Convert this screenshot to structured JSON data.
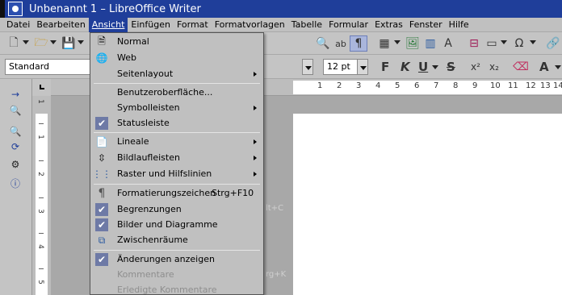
{
  "window": {
    "title": "Unbenannt 1 – LibreOffice Writer"
  },
  "menubar": {
    "items": [
      "Datei",
      "Bearbeiten",
      "Ansicht",
      "Einfügen",
      "Format",
      "Formatvorlagen",
      "Tabelle",
      "Formular",
      "Extras",
      "Fenster",
      "Hilfe"
    ],
    "active": "Ansicht"
  },
  "formatting": {
    "paragraph_style": "Standard",
    "font_size": "12 pt",
    "bold": "F",
    "italic": "K",
    "underline": "U",
    "strikethrough": "S",
    "superscript": "x²",
    "subscript": "x₂"
  },
  "ruler": {
    "h_numbers": [
      "1",
      "2",
      "3",
      "4",
      "5",
      "6",
      "7",
      "8",
      "9",
      "10",
      "11",
      "12",
      "13",
      "14"
    ],
    "v_numbers": [
      "1",
      "1",
      "2",
      "3",
      "4",
      "5"
    ]
  },
  "ghost_text": {
    "shortcut1": "lt+C",
    "shortcut2": "rg+K"
  },
  "view_menu": {
    "normal": "Normal",
    "web": "Web",
    "page_layout": "Seitenlayout",
    "ui": "Benutzeroberfläche...",
    "toolbars": "Symbolleisten",
    "status_bar": "Statusleiste",
    "rulers": "Lineale",
    "scrollbars": "Bildlaufleisten",
    "grid": "Raster und Hilfslinien",
    "formatting_marks": "Formatierungszeichen",
    "formatting_marks_shortcut": "Strg+F10",
    "boundaries": "Begrenzungen",
    "images": "Bilder und Diagramme",
    "whitespace": "Zwischenräume",
    "track_changes": "Änderungen anzeigen",
    "comments": "Kommentare",
    "resolved_comments": "Erledigte Kommentare"
  },
  "colors": {
    "title_bar": "#1f3e9a",
    "menu_highlight": "#1f3e9a",
    "check_bg": "#6e7aa6",
    "menu_bg": "#c0c0c0"
  }
}
